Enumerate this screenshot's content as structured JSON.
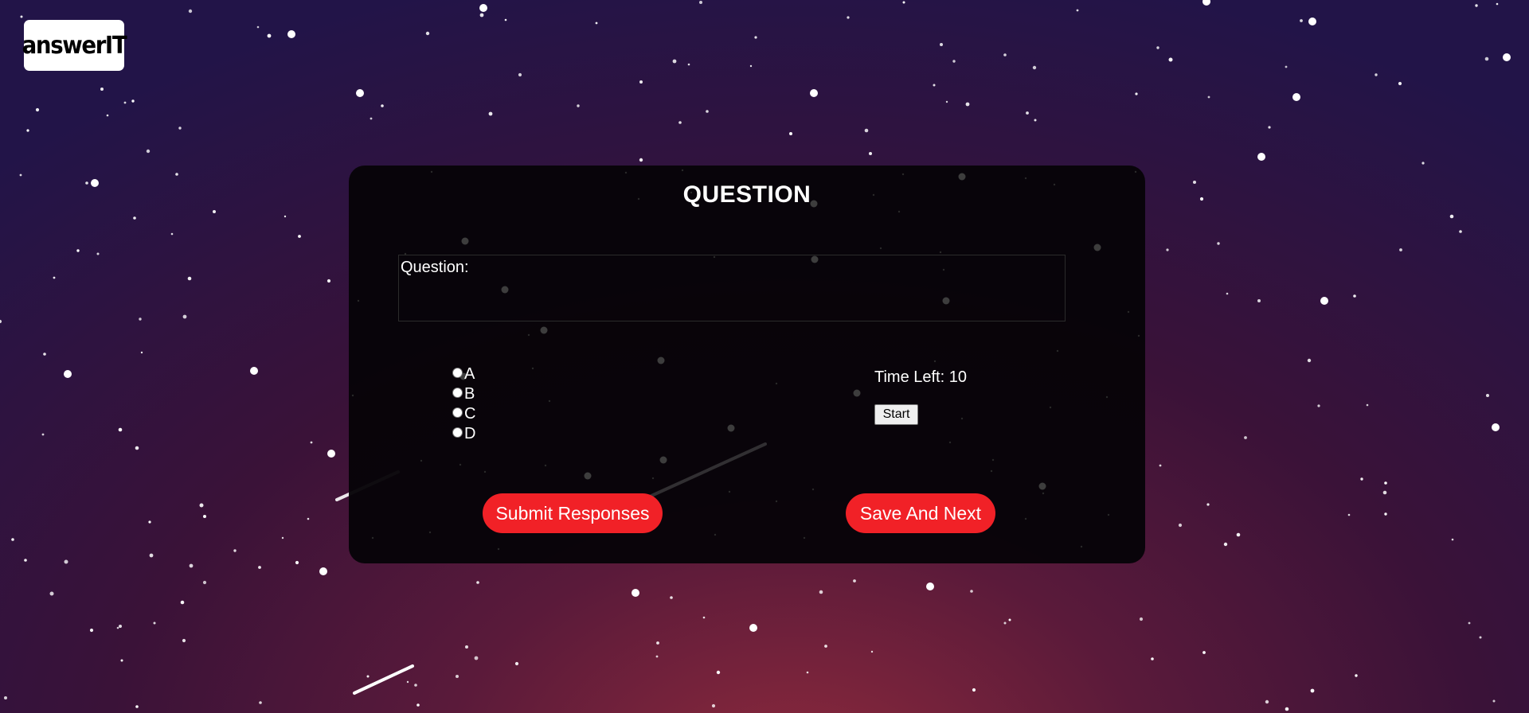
{
  "logo": {
    "text": "answerIT"
  },
  "card": {
    "title": "QUESTION",
    "question_label": "Question:",
    "question_text": "",
    "options": [
      {
        "label": "A",
        "selected": false
      },
      {
        "label": "B",
        "selected": false
      },
      {
        "label": "C",
        "selected": false
      },
      {
        "label": "D",
        "selected": false
      }
    ],
    "timer_label": "Time Left: 10",
    "start_label": "Start",
    "submit_label": "Submit Responses",
    "save_next_label": "Save And Next"
  },
  "colors": {
    "accent_button": "#f12127",
    "card_background": "#070408",
    "background_top": "#221448",
    "background_glow": "#8e2a3c"
  }
}
